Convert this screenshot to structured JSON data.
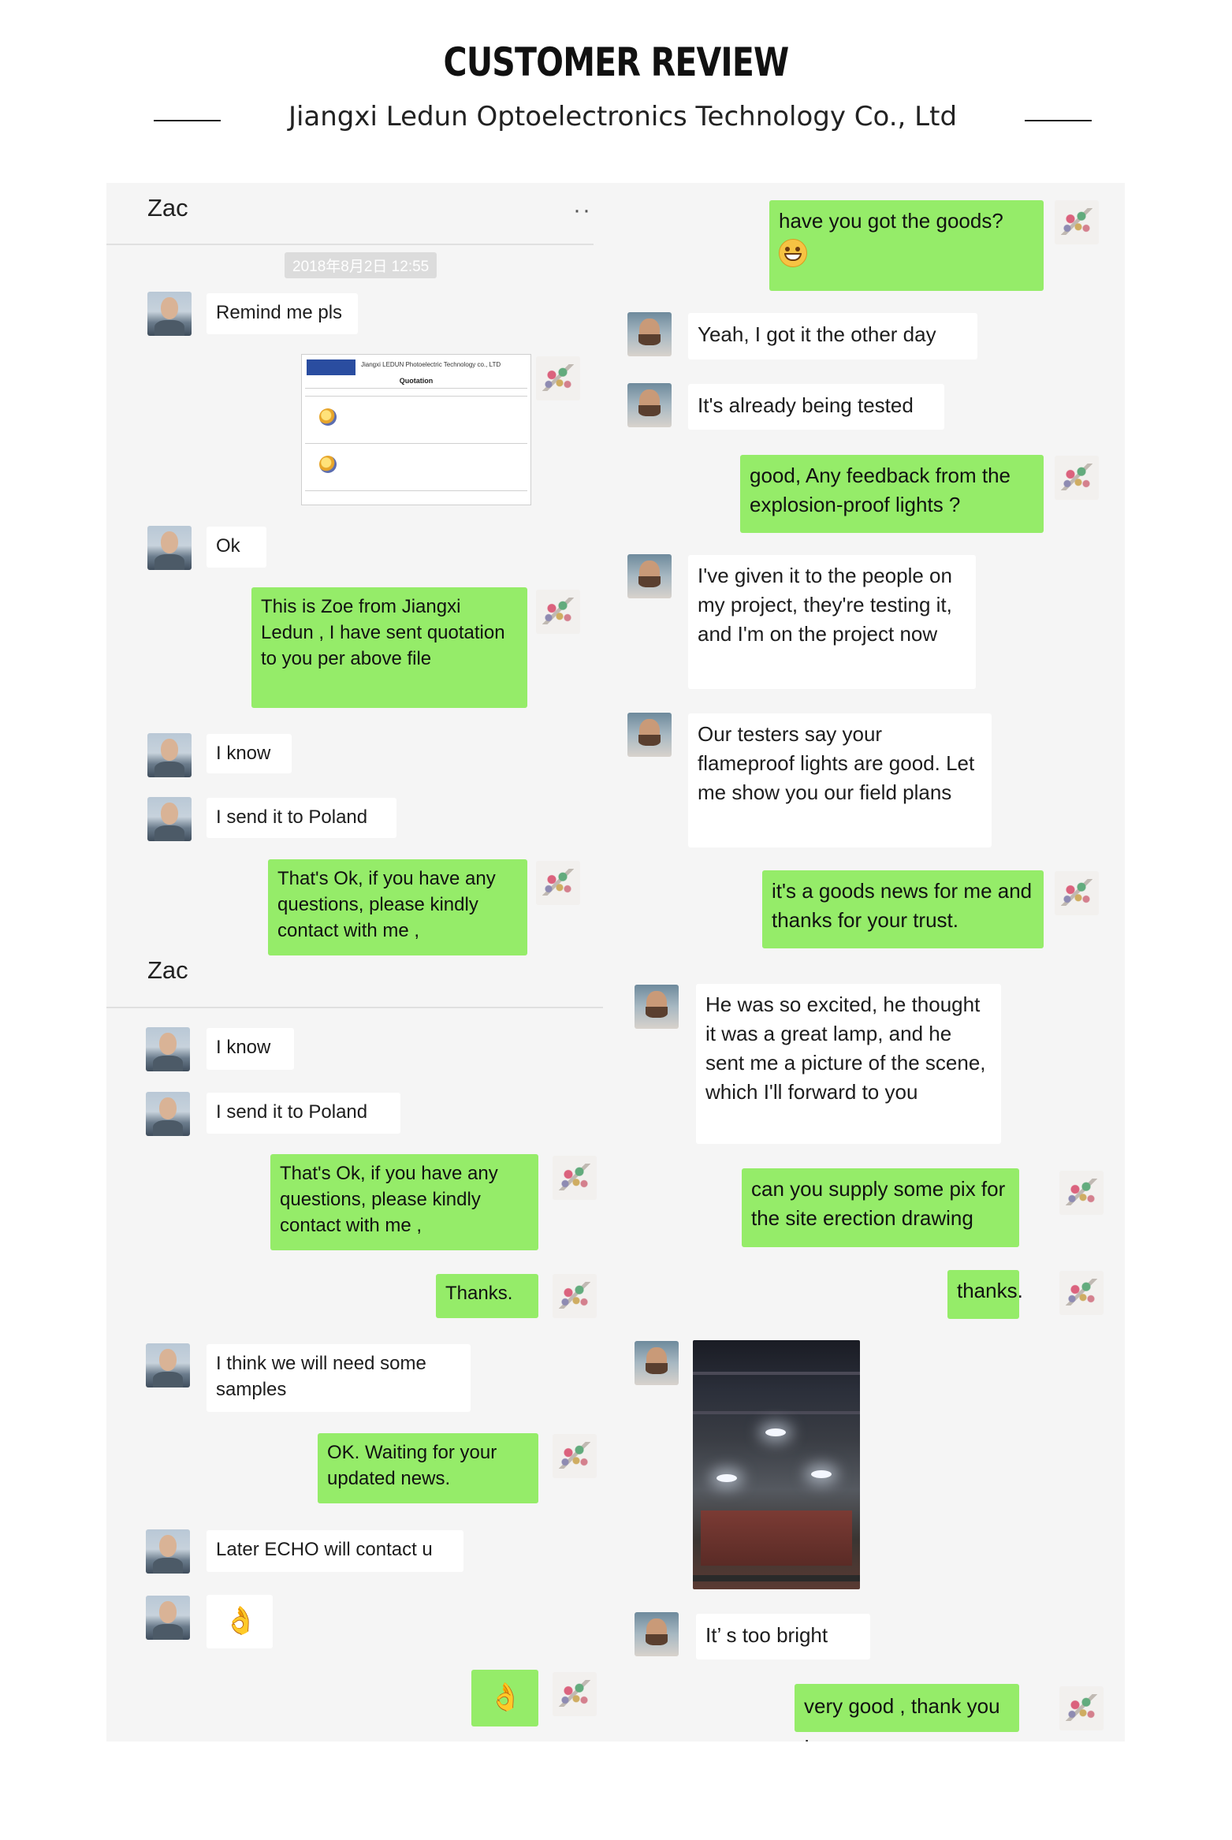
{
  "header": {
    "title": "CUSTOMER REVIEW",
    "subtitle": "Jiangxi Ledun Optoelectronics Technology Co., Ltd"
  },
  "panel1": {
    "contact_name": "Zac",
    "timestamp": "2018年8月2日 12:55",
    "messages": {
      "m1": "Remind me pls",
      "m3": "Ok",
      "m4": "This is Zoe  from Jiangxi Ledun , I have sent quotation to you per above file",
      "m5": "I know",
      "m6": "I send it to Poland",
      "m7": "That's Ok, if you have any questions, please kindly contact with me ,"
    },
    "quotation_doc": {
      "company": "Jiangxi LEDUN Photoelectric Technology co., LTD",
      "title": "Quotation"
    }
  },
  "panel2": {
    "messages": {
      "m1": "have you got the goods?",
      "m2": "Yeah, I got it the other day",
      "m3": "It's already being tested",
      "m4": "good, Any feedback from the explosion-proof lights ?",
      "m5": "I've given it to the people on my project, they're testing it, and I'm on the project now",
      "m6": "Our testers say your flameproof lights are good. Let me show you our field plans",
      "m7": "it's a goods news for me and thanks for your trust."
    }
  },
  "panel3": {
    "contact_name": "Zac",
    "messages": {
      "m1": "I know",
      "m2": "I send it to Poland",
      "m3": "That's Ok, if you have any questions, please kindly contact with me ,",
      "m4": "Thanks.",
      "m5": "I think we will need some samples",
      "m6": "OK. Waiting for your updated news.",
      "m7": "Later ECHO will contact u"
    }
  },
  "panel4": {
    "messages": {
      "m1": "He was so excited, he thought it was a great lamp, and he sent me a picture of the scene, which I'll forward to you",
      "m2": "can you supply some pix for the site erection drawing",
      "m3": "thanks.",
      "m5": "It’  s too bright",
      "m6": "very good , thank you ."
    }
  },
  "colors": {
    "outgoing_bubble": "#95ec69",
    "incoming_bubble": "#ffffff",
    "panel_background": "#f5f5f5"
  },
  "icons": {
    "ok_hand": "👌"
  }
}
